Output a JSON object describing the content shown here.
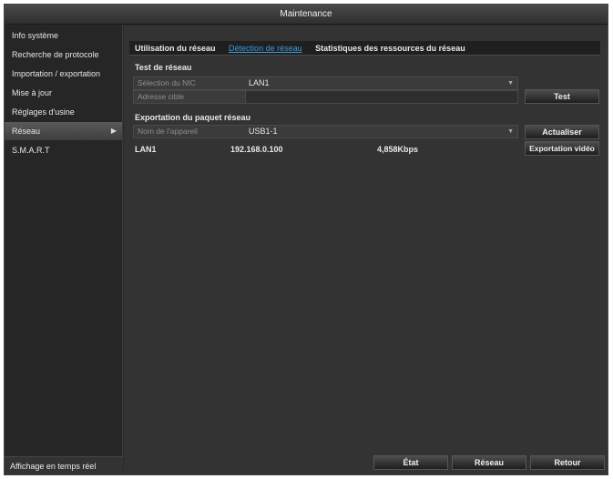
{
  "window": {
    "title": "Maintenance"
  },
  "sidebar": {
    "items": [
      {
        "label": "Info système"
      },
      {
        "label": "Recherche de protocole"
      },
      {
        "label": "Importation / exportation"
      },
      {
        "label": "Mise à jour"
      },
      {
        "label": "Réglages d'usine"
      },
      {
        "label": "Réseau"
      },
      {
        "label": "S.M.A.R.T"
      }
    ],
    "active_index": 5,
    "bottom_label": "Affichage en temps réel"
  },
  "tabs": [
    {
      "label": "Utilisation du réseau"
    },
    {
      "label": "Détection de réseau"
    },
    {
      "label": "Statistiques des ressources du réseau"
    }
  ],
  "network_test": {
    "title": "Test de réseau",
    "nic_label": "Sélection du NIC",
    "nic_value": "LAN1",
    "address_label": "Adresse cible",
    "address_value": "",
    "test_button": "Test"
  },
  "packet_export": {
    "title": "Exportation du paquet réseau",
    "device_label": "Nom de l'appareil",
    "device_value": "USB1-1",
    "refresh_button": "Actualiser",
    "export_button": "Exportation vidéo",
    "rows": [
      {
        "iface": "LAN1",
        "ip": "192.168.0.100",
        "rate": "4,858Kbps"
      }
    ]
  },
  "footer": {
    "state_button": "État",
    "network_button": "Réseau",
    "back_button": "Retour"
  }
}
